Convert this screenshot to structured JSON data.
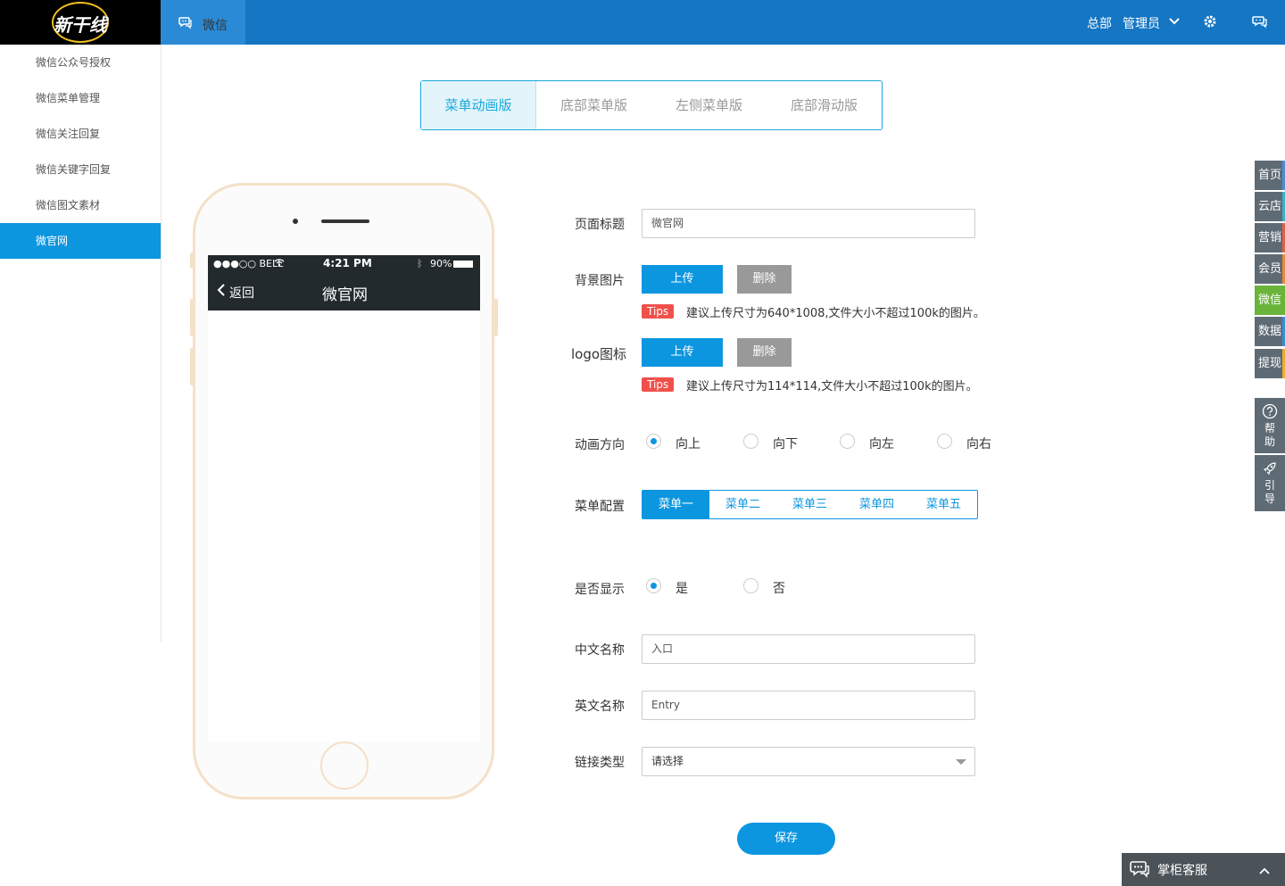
{
  "logo": {
    "text": "新干线"
  },
  "topbar": {
    "tab_label": "微信",
    "org": "总部",
    "user": "管理员"
  },
  "sidebar": {
    "items": [
      {
        "label": "微信公众号授权"
      },
      {
        "label": "微信菜单管理"
      },
      {
        "label": "微信关注回复"
      },
      {
        "label": "微信关键字回复"
      },
      {
        "label": "微信图文素材"
      },
      {
        "label": "微官网",
        "active": true
      }
    ]
  },
  "version_tabs": [
    "菜单动画版",
    "底部菜单版",
    "左侧菜单版",
    "底部滑动版"
  ],
  "phone": {
    "signal": "●●●○○ BELL",
    "time": "4:21 PM",
    "battery": "90%",
    "back_label": "返回",
    "title": "微官网"
  },
  "form": {
    "page_title_label": "页面标题",
    "page_title_value": "微官网",
    "bg_label": "背景图片",
    "upload": "上传",
    "delete": "删除",
    "tips": "Tips",
    "bg_tip": "建议上传尺寸为640*1008,文件大小不超过100k的图片。",
    "logo_label": "logo图标",
    "logo_tip": "建议上传尺寸为114*114,文件大小不超过100k的图片。",
    "direction_label": "动画方向",
    "directions": [
      "向上",
      "向下",
      "向左",
      "向右"
    ],
    "menu_config_label": "菜单配置",
    "menus": [
      "菜单一",
      "菜单二",
      "菜单三",
      "菜单四",
      "菜单五"
    ],
    "show_label": "是否显示",
    "show_yes": "是",
    "show_no": "否",
    "cn_name_label": "中文名称",
    "cn_name_value": "入口",
    "en_name_label": "英文名称",
    "en_name_value": "Entry",
    "link_type_label": "链接类型",
    "link_type_value": "请选择",
    "save": "保存"
  },
  "dock": {
    "items": [
      {
        "label": "首页",
        "accent": "#4a8fd6"
      },
      {
        "label": "云店",
        "accent": "#3bb3c3"
      },
      {
        "label": "营销",
        "accent": "#e0604a"
      },
      {
        "label": "会员",
        "accent": "#e88a3a"
      },
      {
        "label": "微信",
        "accent": "#6ab43a",
        "active": true
      },
      {
        "label": "数据",
        "accent": "#3a8fd6"
      },
      {
        "label": "提现",
        "accent": "#e8b030"
      }
    ],
    "help": "帮助",
    "guide": "引导"
  },
  "kefu": {
    "label": "掌柜客服"
  },
  "colors": {
    "primary": "#0d96e0",
    "topbar": "#1576c4",
    "danger": "#f0504a"
  }
}
